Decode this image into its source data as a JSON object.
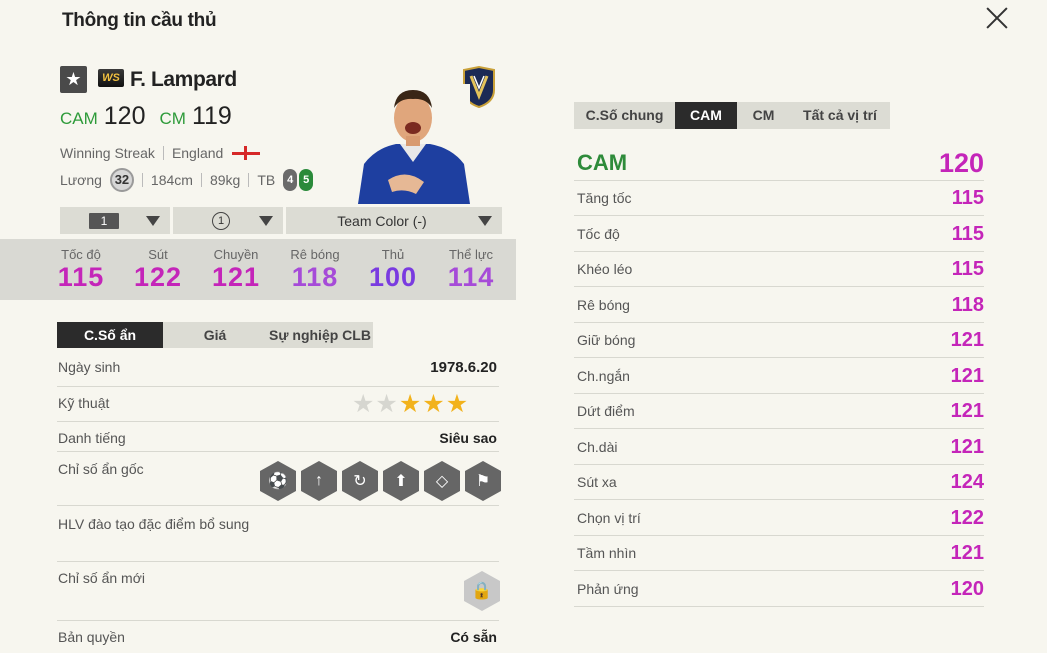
{
  "header": {
    "title": "Thông tin cầu thủ"
  },
  "player": {
    "star": "★",
    "season_badge": "WS",
    "name": "F. Lampard",
    "positions": [
      {
        "pos": "CAM",
        "ovr": "120"
      },
      {
        "pos": "CM",
        "ovr": "119"
      }
    ],
    "season_name": "Winning Streak",
    "nation": "England",
    "salary_label": "Lương",
    "salary": "32",
    "height": "184cm",
    "weight": "89kg",
    "body_type": "TB",
    "weak_foot": "4",
    "strong_foot": "5"
  },
  "selectors": {
    "level": "1",
    "adapt": "1",
    "team_color": "Team Color (-)"
  },
  "main_stats": [
    {
      "label": "Tốc độ",
      "value": "115",
      "color": "#c425b9"
    },
    {
      "label": "Sút",
      "value": "122",
      "color": "#c425b9"
    },
    {
      "label": "Chuyền",
      "value": "121",
      "color": "#c425b9"
    },
    {
      "label": "Rê bóng",
      "value": "118",
      "color": "#a64bd8"
    },
    {
      "label": "Thủ",
      "value": "100",
      "color": "#7a3be0"
    },
    {
      "label": "Thể lực",
      "value": "114",
      "color": "#a64bd8"
    }
  ],
  "left_tabs": [
    {
      "label": "C.Số ẩn",
      "active": true
    },
    {
      "label": "Giá",
      "active": false
    },
    {
      "label": "Sự nghiệp CLB",
      "active": false
    }
  ],
  "info": {
    "birth_label": "Ngày sinh",
    "birth_value": "1978.6.20",
    "skill_label": "Kỹ thuật",
    "skill_stars": 3,
    "skill_stars_max": 5,
    "fame_label": "Danh tiếng",
    "fame_value": "Siêu sao",
    "traits_label": "Chỉ số ẩn gốc",
    "trainer_label": "HLV đào tạo đặc điểm bổ sung",
    "new_traits_label": "Chỉ số ẩn mới",
    "license_label": "Bản quyền",
    "license_value": "Có sẵn"
  },
  "trait_icons": [
    "long-shot-icon",
    "finesse-icon",
    "dribbler-icon",
    "power-header-icon",
    "playmaker-icon",
    "team-player-icon"
  ],
  "right_tabs": [
    {
      "label": "C.Số chung",
      "active": false
    },
    {
      "label": "CAM",
      "active": true
    },
    {
      "label": "CM",
      "active": false
    },
    {
      "label": "Tất cả vị trí",
      "active": false
    }
  ],
  "position_rating": {
    "label": "CAM",
    "value": "120"
  },
  "attributes": [
    {
      "label": "Tăng tốc",
      "value": "115",
      "color": "#c425b9"
    },
    {
      "label": "Tốc độ",
      "value": "115",
      "color": "#c425b9"
    },
    {
      "label": "Khéo léo",
      "value": "115",
      "color": "#c425b9"
    },
    {
      "label": "Rê bóng",
      "value": "118",
      "color": "#c425b9"
    },
    {
      "label": "Giữ bóng",
      "value": "121",
      "color": "#c425b9"
    },
    {
      "label": "Ch.ngắn",
      "value": "121",
      "color": "#c425b9"
    },
    {
      "label": "Dứt điểm",
      "value": "121",
      "color": "#c425b9"
    },
    {
      "label": "Ch.dài",
      "value": "121",
      "color": "#c425b9"
    },
    {
      "label": "Sút xa",
      "value": "124",
      "color": "#c425b9"
    },
    {
      "label": "Chọn vị trí",
      "value": "122",
      "color": "#c425b9"
    },
    {
      "label": "Tầm nhìn",
      "value": "121",
      "color": "#c425b9"
    },
    {
      "label": "Phản ứng",
      "value": "120",
      "color": "#c425b9"
    }
  ]
}
